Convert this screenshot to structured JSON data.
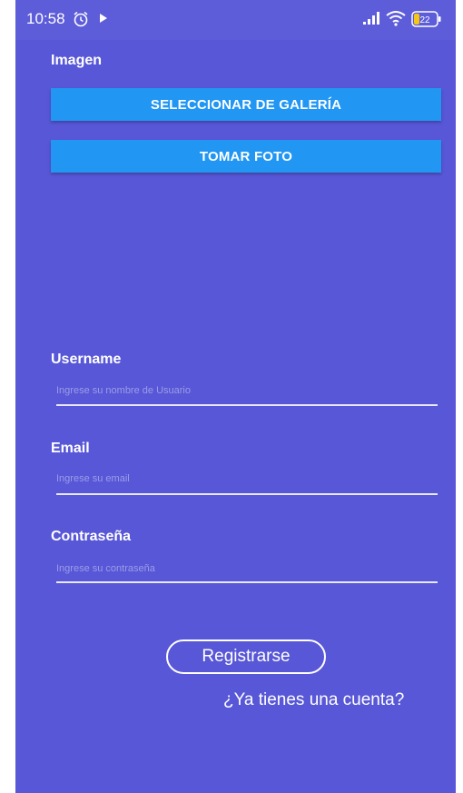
{
  "status_bar": {
    "time": "10:58",
    "battery": "22",
    "icons": [
      "alarm-icon",
      "play-icon",
      "signal-icon",
      "wifi-icon",
      "battery-icon"
    ]
  },
  "image_section": {
    "label": "Imagen",
    "gallery_button": "SELECCIONAR DE GALERÍA",
    "camera_button": "TOMAR FOTO"
  },
  "form": {
    "username": {
      "label": "Username",
      "placeholder": "Ingrese su nombre de Usuario"
    },
    "email": {
      "label": "Email",
      "placeholder": "Ingrese su email"
    },
    "password": {
      "label": "Contraseña",
      "placeholder": "Ingrese su contraseña"
    }
  },
  "actions": {
    "register": "Registrarse",
    "login_link": "¿Ya tienes una cuenta?"
  },
  "colors": {
    "background": "#5857d7",
    "button": "#2196f3",
    "text": "#ffffff"
  }
}
